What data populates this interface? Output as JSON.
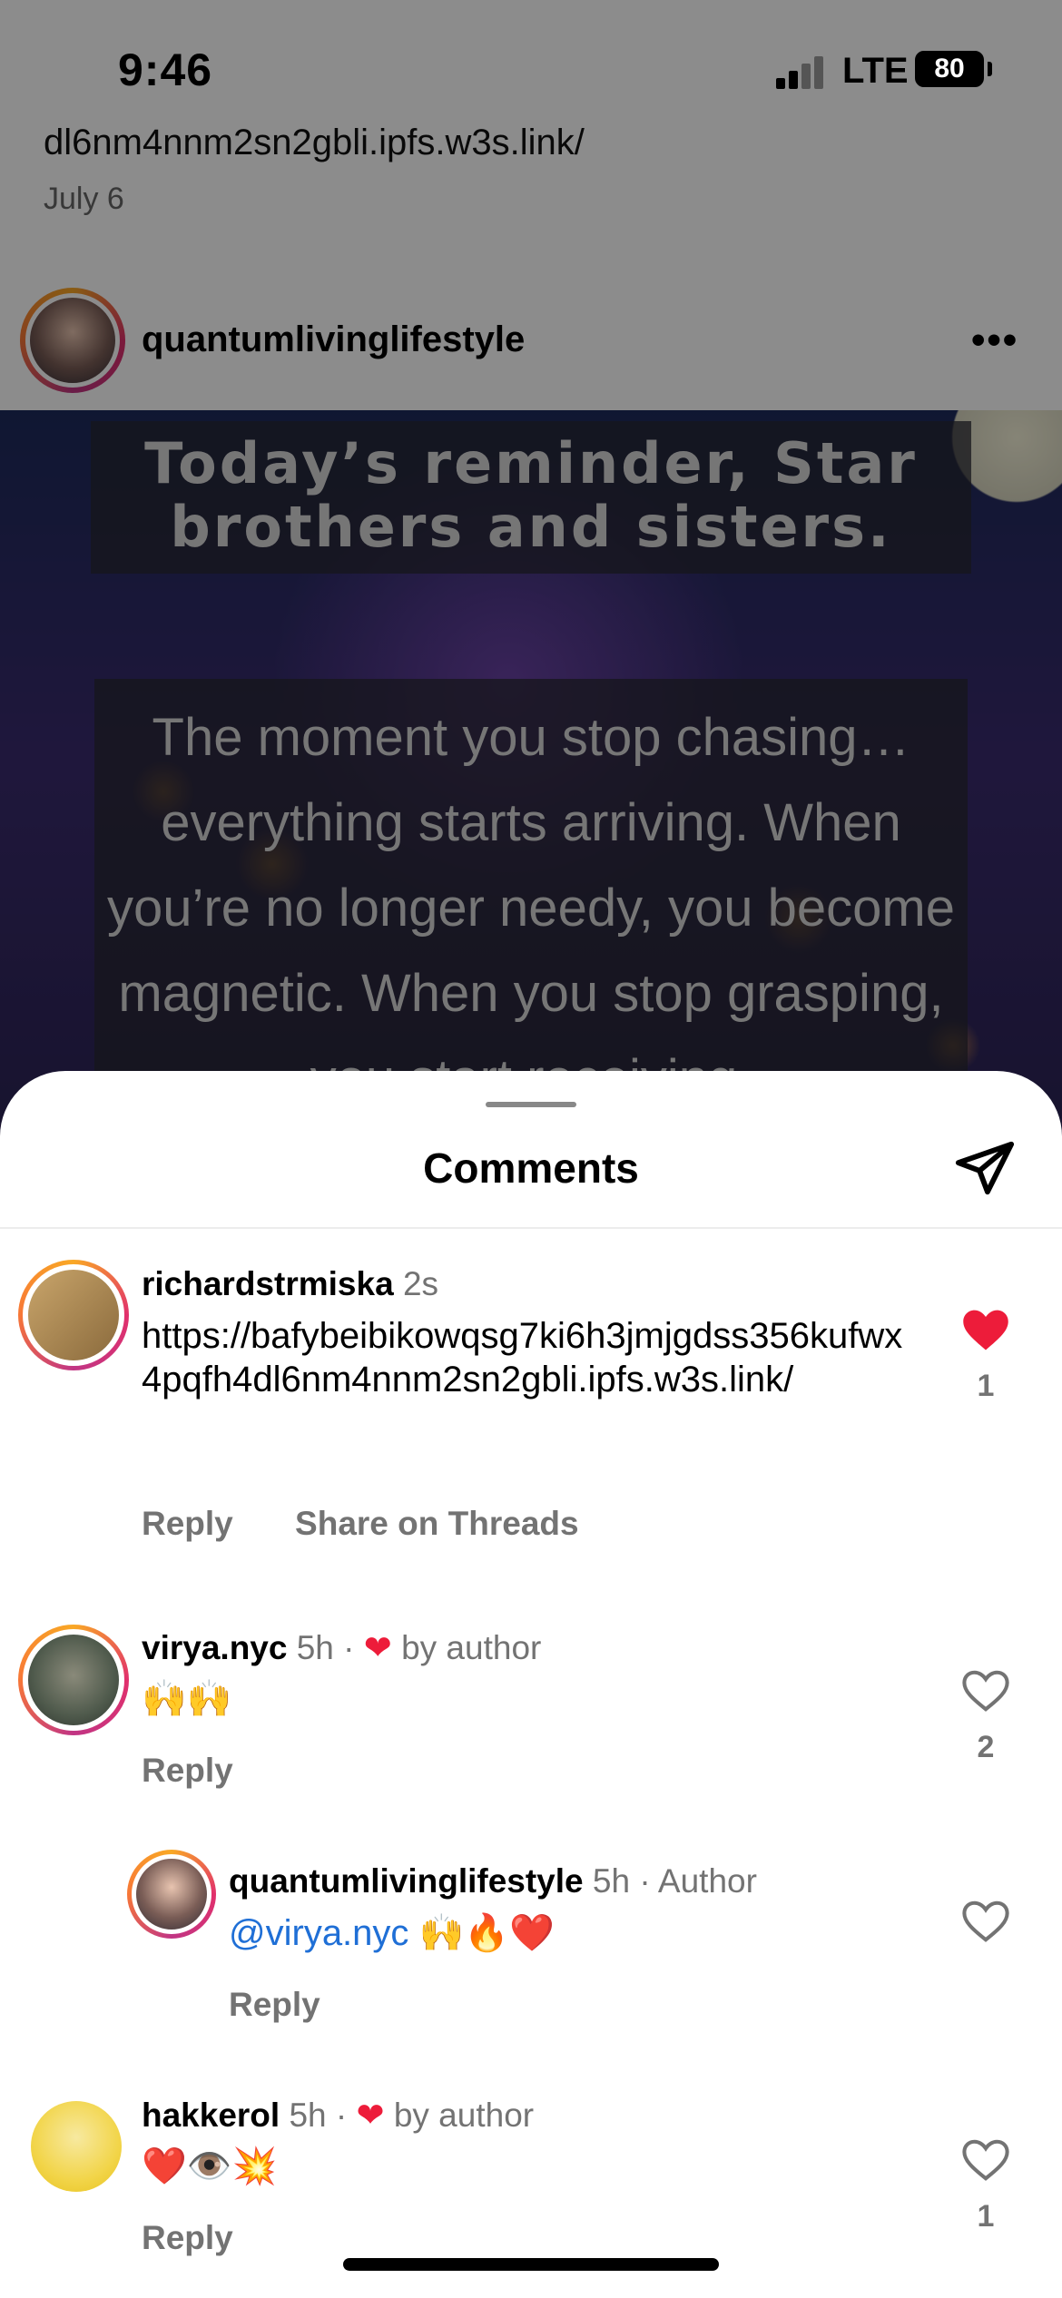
{
  "status_bar": {
    "time": "9:46",
    "network": "LTE",
    "battery": "80"
  },
  "feed": {
    "previous_link": "dl6nm4nnm2sn2gbli.ipfs.w3s.link/",
    "previous_date": "July 6",
    "post_username": "quantumlivinglifestyle",
    "image_title": "Today’s reminder, Star brothers and sisters.",
    "image_body": "The moment you stop chasing… everything starts arriving. When you’re no longer needy, you become magnetic. When you stop grasping, you start receiving."
  },
  "sheet": {
    "title": "Comments"
  },
  "comments": [
    {
      "username": "richardstrmiska",
      "time": "2s",
      "text": "https://bafybeibikowqsg7ki6h3jmjgdss356kufwx4pqfh4dl6nm4nnm2sn2gbli.ipfs.w3s.link/",
      "reply": "Reply",
      "share": "Share on Threads",
      "likes": "1",
      "liked": true
    },
    {
      "username": "virya.nyc",
      "time": "5h",
      "separator": "·",
      "badge": "by author",
      "text": "🙌🙌",
      "reply": "Reply",
      "likes": "2",
      "liked": false
    },
    {
      "username": "quantumlivinglifestyle",
      "time": "5h",
      "separator": "·",
      "badge": "Author",
      "mention": "@virya.nyc",
      "text": "🙌🔥❤️",
      "reply": "Reply",
      "liked": false
    },
    {
      "username": "hakkerol",
      "time": "5h",
      "separator": "·",
      "badge": "by author",
      "text": "❤️👁️💥",
      "reply": "Reply",
      "likes": "1",
      "liked": false
    }
  ],
  "colors": {
    "like_red": "#ed1c3a",
    "mention_blue": "#1f6fd6",
    "meta_gray": "#737373"
  },
  "icons": [
    "send-icon",
    "heart-icon",
    "more-icon",
    "signal-icon",
    "battery-icon"
  ]
}
